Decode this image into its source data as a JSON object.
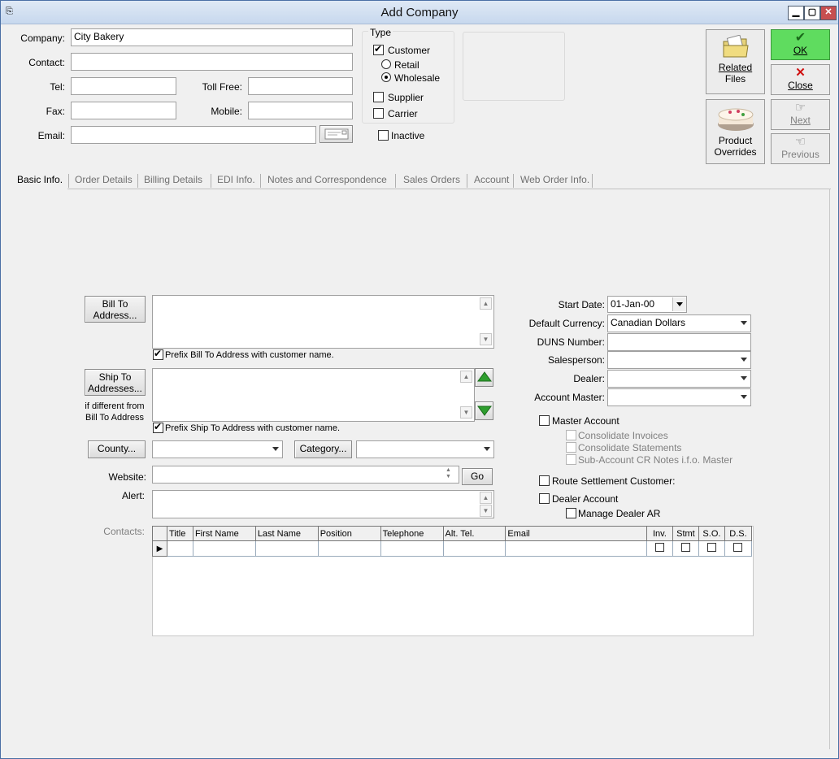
{
  "window": {
    "title": "Add Company"
  },
  "titlebar_buttons": {
    "minimize": "▁",
    "restore": "▢",
    "close": "✕"
  },
  "fields": {
    "company_label": "Company:",
    "company_value": "City Bakery",
    "contact_label": "Contact:",
    "contact_value": "",
    "tel_label": "Tel:",
    "tel_value": "",
    "toll_free_label": "Toll Free:",
    "toll_free_value": "",
    "fax_label": "Fax:",
    "fax_value": "",
    "mobile_label": "Mobile:",
    "mobile_value": "",
    "email_label": "Email:",
    "email_value": ""
  },
  "type_group": {
    "legend": "Type",
    "customer": "Customer",
    "customer_checked": true,
    "retail": "Retail",
    "wholesale": "Wholesale",
    "selected": "Wholesale",
    "supplier": "Supplier",
    "carrier": "Carrier"
  },
  "inactive_label": "Inactive",
  "action_buttons": {
    "related_files_line1": "Related",
    "related_files_line2": "Files",
    "product_overrides_line1": "Product",
    "product_overrides_line2": "Overrides",
    "ok": "OK",
    "close": "Close",
    "next": "Next",
    "previous": "Previous"
  },
  "tabs": [
    {
      "label": "Basic Info.",
      "active": true
    },
    {
      "label": "Order Details",
      "active": false
    },
    {
      "label": "Billing Details",
      "active": false
    },
    {
      "label": "EDI Info.",
      "active": false
    },
    {
      "label": "Notes and Correspondence",
      "active": false
    },
    {
      "label": "Sales Orders",
      "active": false
    },
    {
      "label": "Account",
      "active": false
    },
    {
      "label": "Web Order Info.",
      "active": false
    }
  ],
  "address": {
    "bill_to_btn_line1": "Bill To",
    "bill_to_btn_line2": "Address...",
    "prefix_bill": "Prefix Bill To Address with customer name.",
    "ship_to_btn_line1": "Ship To",
    "ship_to_btn_line2": "Addresses...",
    "ship_note_line1": "if different from",
    "ship_note_line2": "Bill To Address",
    "prefix_ship": "Prefix Ship To Address with customer name."
  },
  "misc": {
    "county_btn": "County...",
    "category_btn": "Category...",
    "website_label": "Website:",
    "go_btn": "Go",
    "alert_label": "Alert:",
    "contacts_label": "Contacts:"
  },
  "right_panel": {
    "start_date_label": "Start Date:",
    "start_date_value": "01-Jan-00",
    "default_currency_label": "Default Currency:",
    "default_currency_value": "Canadian Dollars",
    "duns_label": "DUNS Number:",
    "duns_value": "",
    "salesperson_label": "Salesperson:",
    "dealer_label": "Dealer:",
    "account_master_label": "Account Master:",
    "master_account": "Master Account",
    "consolidate_invoices": "Consolidate Invoices",
    "consolidate_statements": "Consolidate Statements",
    "sub_account_cr": "Sub-Account CR Notes i.f.o. Master",
    "route_settlement": "Route Settlement Customer:",
    "dealer_account": "Dealer Account",
    "manage_dealer_ar": "Manage Dealer AR"
  },
  "contacts_grid": {
    "columns": [
      "Title",
      "First Name",
      "Last Name",
      "Position",
      "Telephone",
      "Alt. Tel.",
      "Email",
      "Inv.",
      "Stmt",
      "S.O.",
      "D.S."
    ]
  },
  "icons": {
    "folder": "folder-icon",
    "cake": "cake-icon",
    "check": "checkmark-icon",
    "close": "red-x-icon",
    "next": "hand-pointing-right-icon",
    "previous": "hand-pointing-left-icon"
  },
  "colors": {
    "ok_green": "#5fdc5f",
    "titlebar": "#c7d8ee",
    "arrow_green": "#2e9e2e"
  }
}
